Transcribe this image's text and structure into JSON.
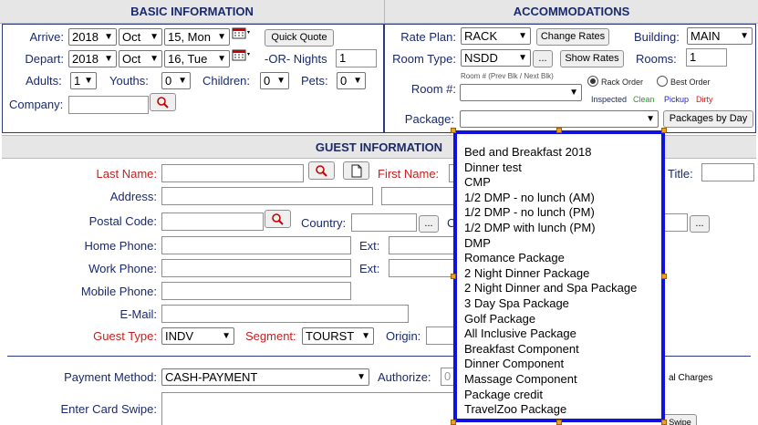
{
  "headers": {
    "basic": "BASIC INFORMATION",
    "accom": "ACCOMMODATIONS",
    "guest": "GUEST INFORMATION"
  },
  "basic": {
    "arrive_label": "Arrive:",
    "depart_label": "Depart:",
    "arrive": {
      "year": "2018",
      "month": "Oct",
      "day": "15, Mon"
    },
    "depart": {
      "year": "2018",
      "month": "Oct",
      "day": "16, Tue"
    },
    "quick_quote": "Quick Quote",
    "or_nights_label": "-OR- Nights",
    "nights": "1",
    "adults_label": "Adults:",
    "adults": "1",
    "youths_label": "Youths:",
    "youths": "0",
    "children_label": "Children:",
    "children": "0",
    "pets_label": "Pets:",
    "pets": "0",
    "company_label": "Company:",
    "company": ""
  },
  "accom": {
    "rate_plan_label": "Rate Plan:",
    "rate_plan": "RACK",
    "change_rates": "Change Rates",
    "building_label": "Building:",
    "building": "MAIN",
    "room_type_label": "Room Type:",
    "room_type": "NSDD",
    "ellipsis": "...",
    "show_rates": "Show Rates",
    "rooms_label": "Rooms:",
    "rooms": "1",
    "room_num_label": "Room #:",
    "room_hint": "Room # (Prev Blk / Next Blk)",
    "rack_order": "Rack Order",
    "best_order": "Best Order",
    "legend": {
      "inspected": "Inspected",
      "clean": "Clean",
      "pickup": "Pickup",
      "dirty": "Dirty"
    },
    "package_label": "Package:",
    "packages_by_day": "Packages by Day"
  },
  "guest": {
    "last_name_label": "Last Name:",
    "first_name_label": "First Name:",
    "title_label": "Title:",
    "address_label": "Address:",
    "postal_code_label": "Postal Code:",
    "country_label": "Country:",
    "country_ellipsis": "...",
    "c_label": "C",
    "home_phone_label": "Home Phone:",
    "ext1_label": "Ext:",
    "work_phone_label": "Work Phone:",
    "ext2_label": "Ext:",
    "mobile_phone_label": "Mobile Phone:",
    "email_label": "E-Mail:",
    "guest_type_label": "Guest Type:",
    "guest_type": "INDV",
    "segment_label": "Segment:",
    "segment": "TOURST",
    "origin_label": "Origin:"
  },
  "payment": {
    "method_label": "Payment Method:",
    "method": "CASH-PAYMENT",
    "authorize_label": "Authorize:",
    "authorize_value": "0",
    "charges_text": "al Charges",
    "card_swipe_label": "Enter Card Swipe:",
    "swipe_btn": "Swipe"
  },
  "package_options": [
    "Bed and Breakfast 2018",
    "Dinner test",
    "CMP",
    "1/2 DMP - no lunch (AM)",
    "1/2 DMP - no lunch (PM)",
    "1/2 DMP with lunch (PM)",
    "DMP",
    "Romance Package",
    "2 Night Dinner Package",
    "2 Night Dinner and Spa Package",
    "3 Day Spa Package",
    "Golf Package",
    "All Inclusive Package",
    "Breakfast Component",
    "Dinner Component",
    "Massage Component",
    "Package credit",
    "TravelZoo Package"
  ],
  "colors": {
    "header_bg": "#e6e6e6",
    "label": "#1a2a6c",
    "required": "#c82020",
    "highlight": "#1010e0",
    "clean": "#20a020",
    "pickup": "#2020d0",
    "dirty": "#d02020"
  }
}
